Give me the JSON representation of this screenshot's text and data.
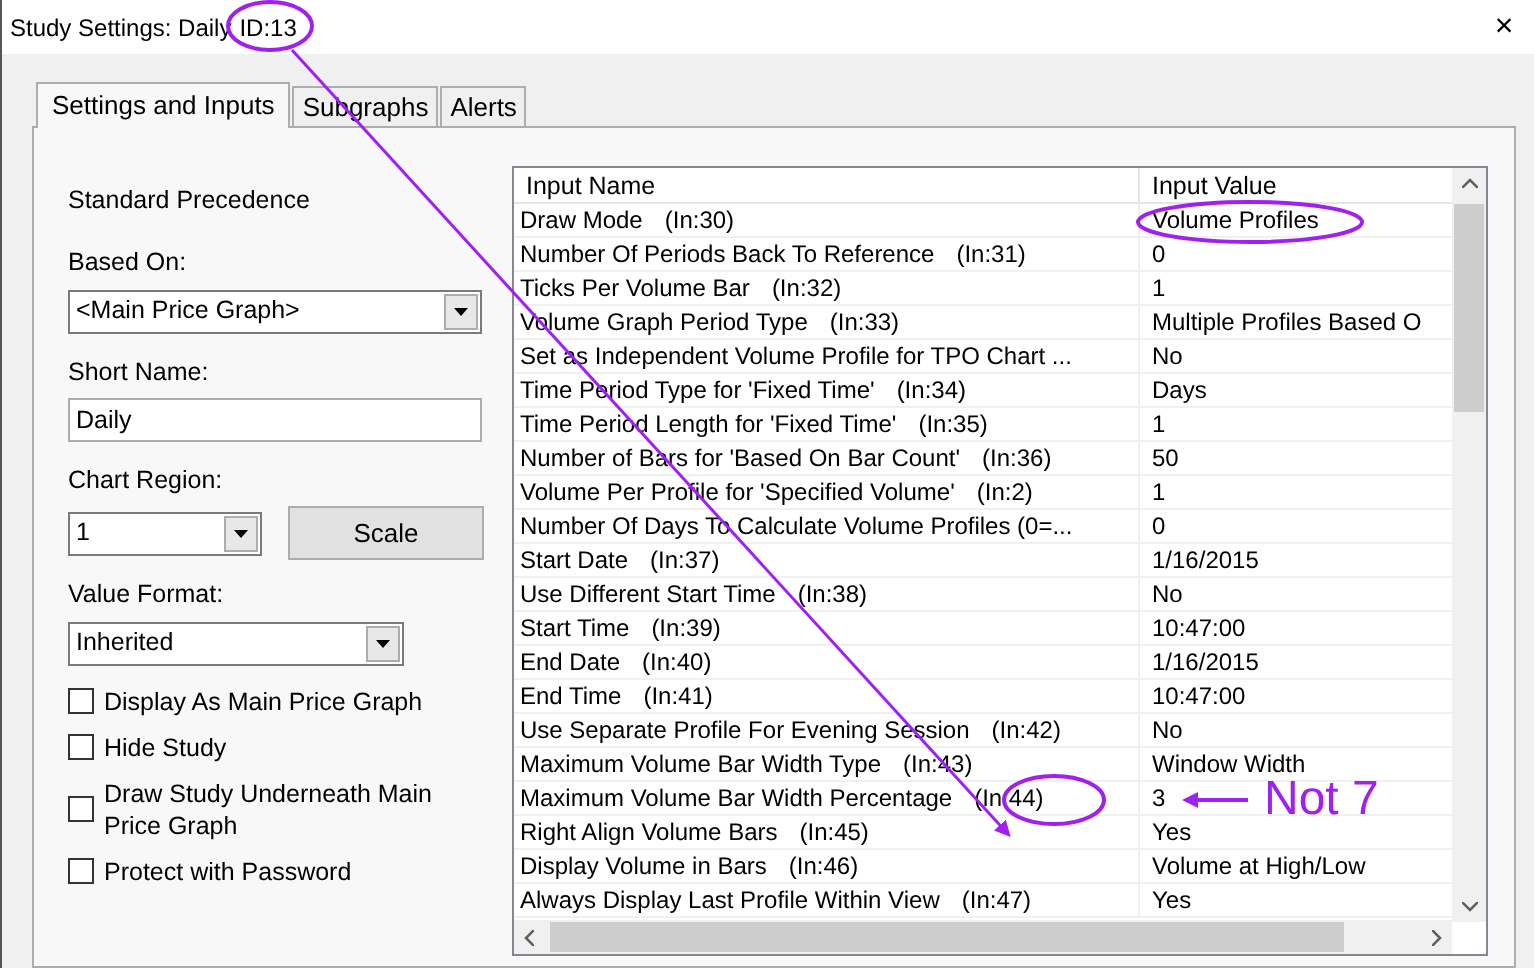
{
  "window": {
    "title": "Study Settings: Daily",
    "id_label": "ID:13",
    "close": "×"
  },
  "tabs": [
    {
      "label": "Settings and Inputs",
      "selected": true
    },
    {
      "label": "Subgraphs",
      "selected": false
    },
    {
      "label": "Alerts",
      "selected": false
    }
  ],
  "settings": {
    "precedence": "Standard Precedence",
    "based_on": {
      "label": "Based On:",
      "value": "<Main Price Graph>"
    },
    "short_name": {
      "label": "Short Name:",
      "value": "Daily"
    },
    "chart_region": {
      "label": "Chart Region:",
      "value": "1"
    },
    "scale_button": "Scale",
    "value_format": {
      "label": "Value Format:",
      "value": "Inherited"
    },
    "checkboxes": [
      {
        "label": "Display As Main Price Graph",
        "checked": false
      },
      {
        "label": "Hide Study",
        "checked": false
      },
      {
        "label": "Draw Study Underneath Main Price Graph",
        "checked": false
      },
      {
        "label": "Protect with Password",
        "checked": false
      }
    ]
  },
  "inputs": {
    "columns": [
      "Input Name",
      "Input Value"
    ],
    "rows": [
      {
        "name": "Draw Mode",
        "ref": "(In:30)",
        "value": "Volume Profiles"
      },
      {
        "name": "Number Of Periods Back To Reference",
        "ref": "(In:31)",
        "value": "0"
      },
      {
        "name": "Ticks Per Volume Bar",
        "ref": "(In:32)",
        "value": "1"
      },
      {
        "name": "Volume Graph Period Type",
        "ref": "(In:33)",
        "value": "Multiple Profiles Based O"
      },
      {
        "name": "Set as Independent Volume Profile for TPO Chart ...",
        "value": "No"
      },
      {
        "name": "Time Period Type for 'Fixed Time'",
        "ref": "(In:34)",
        "value": "Days"
      },
      {
        "name": "Time Period Length for 'Fixed Time'",
        "ref": "(In:35)",
        "value": "1"
      },
      {
        "name": "Number of Bars for 'Based On Bar Count'",
        "ref": "(In:36)",
        "value": "50"
      },
      {
        "name": "Volume Per Profile for 'Specified Volume'",
        "ref": "(In:2)",
        "value": "1"
      },
      {
        "name": "Number Of Days To Calculate Volume Profiles (0=...",
        "value": "0"
      },
      {
        "name": "Start Date",
        "ref": "(In:37)",
        "value": "1/16/2015"
      },
      {
        "name": "Use Different Start Time",
        "ref": "(In:38)",
        "value": "No"
      },
      {
        "name": "Start Time",
        "ref": "(In:39)",
        "value": "10:47:00"
      },
      {
        "name": "End Date",
        "ref": "(In:40)",
        "value": "1/16/2015"
      },
      {
        "name": "End Time",
        "ref": "(In:41)",
        "value": "10:47:00"
      },
      {
        "name": "Use Separate Profile For Evening Session",
        "ref": "(In:42)",
        "value": "No"
      },
      {
        "name": "Maximum Volume Bar Width Type",
        "ref": "(In:43)",
        "value": "Window Width"
      },
      {
        "name": "Maximum Volume Bar Width Percentage",
        "ref": "(In:44)",
        "value": "3"
      },
      {
        "name": "Right Align Volume Bars",
        "ref": "(In:45)",
        "value": "Yes"
      },
      {
        "name": "Display Volume in Bars",
        "ref": "(In:46)",
        "value": "Volume at High/Low"
      },
      {
        "name": "Always Display Last Profile Within View",
        "ref": "(In:47)",
        "value": "Yes"
      }
    ]
  },
  "annotation": {
    "note": "Not 7"
  }
}
